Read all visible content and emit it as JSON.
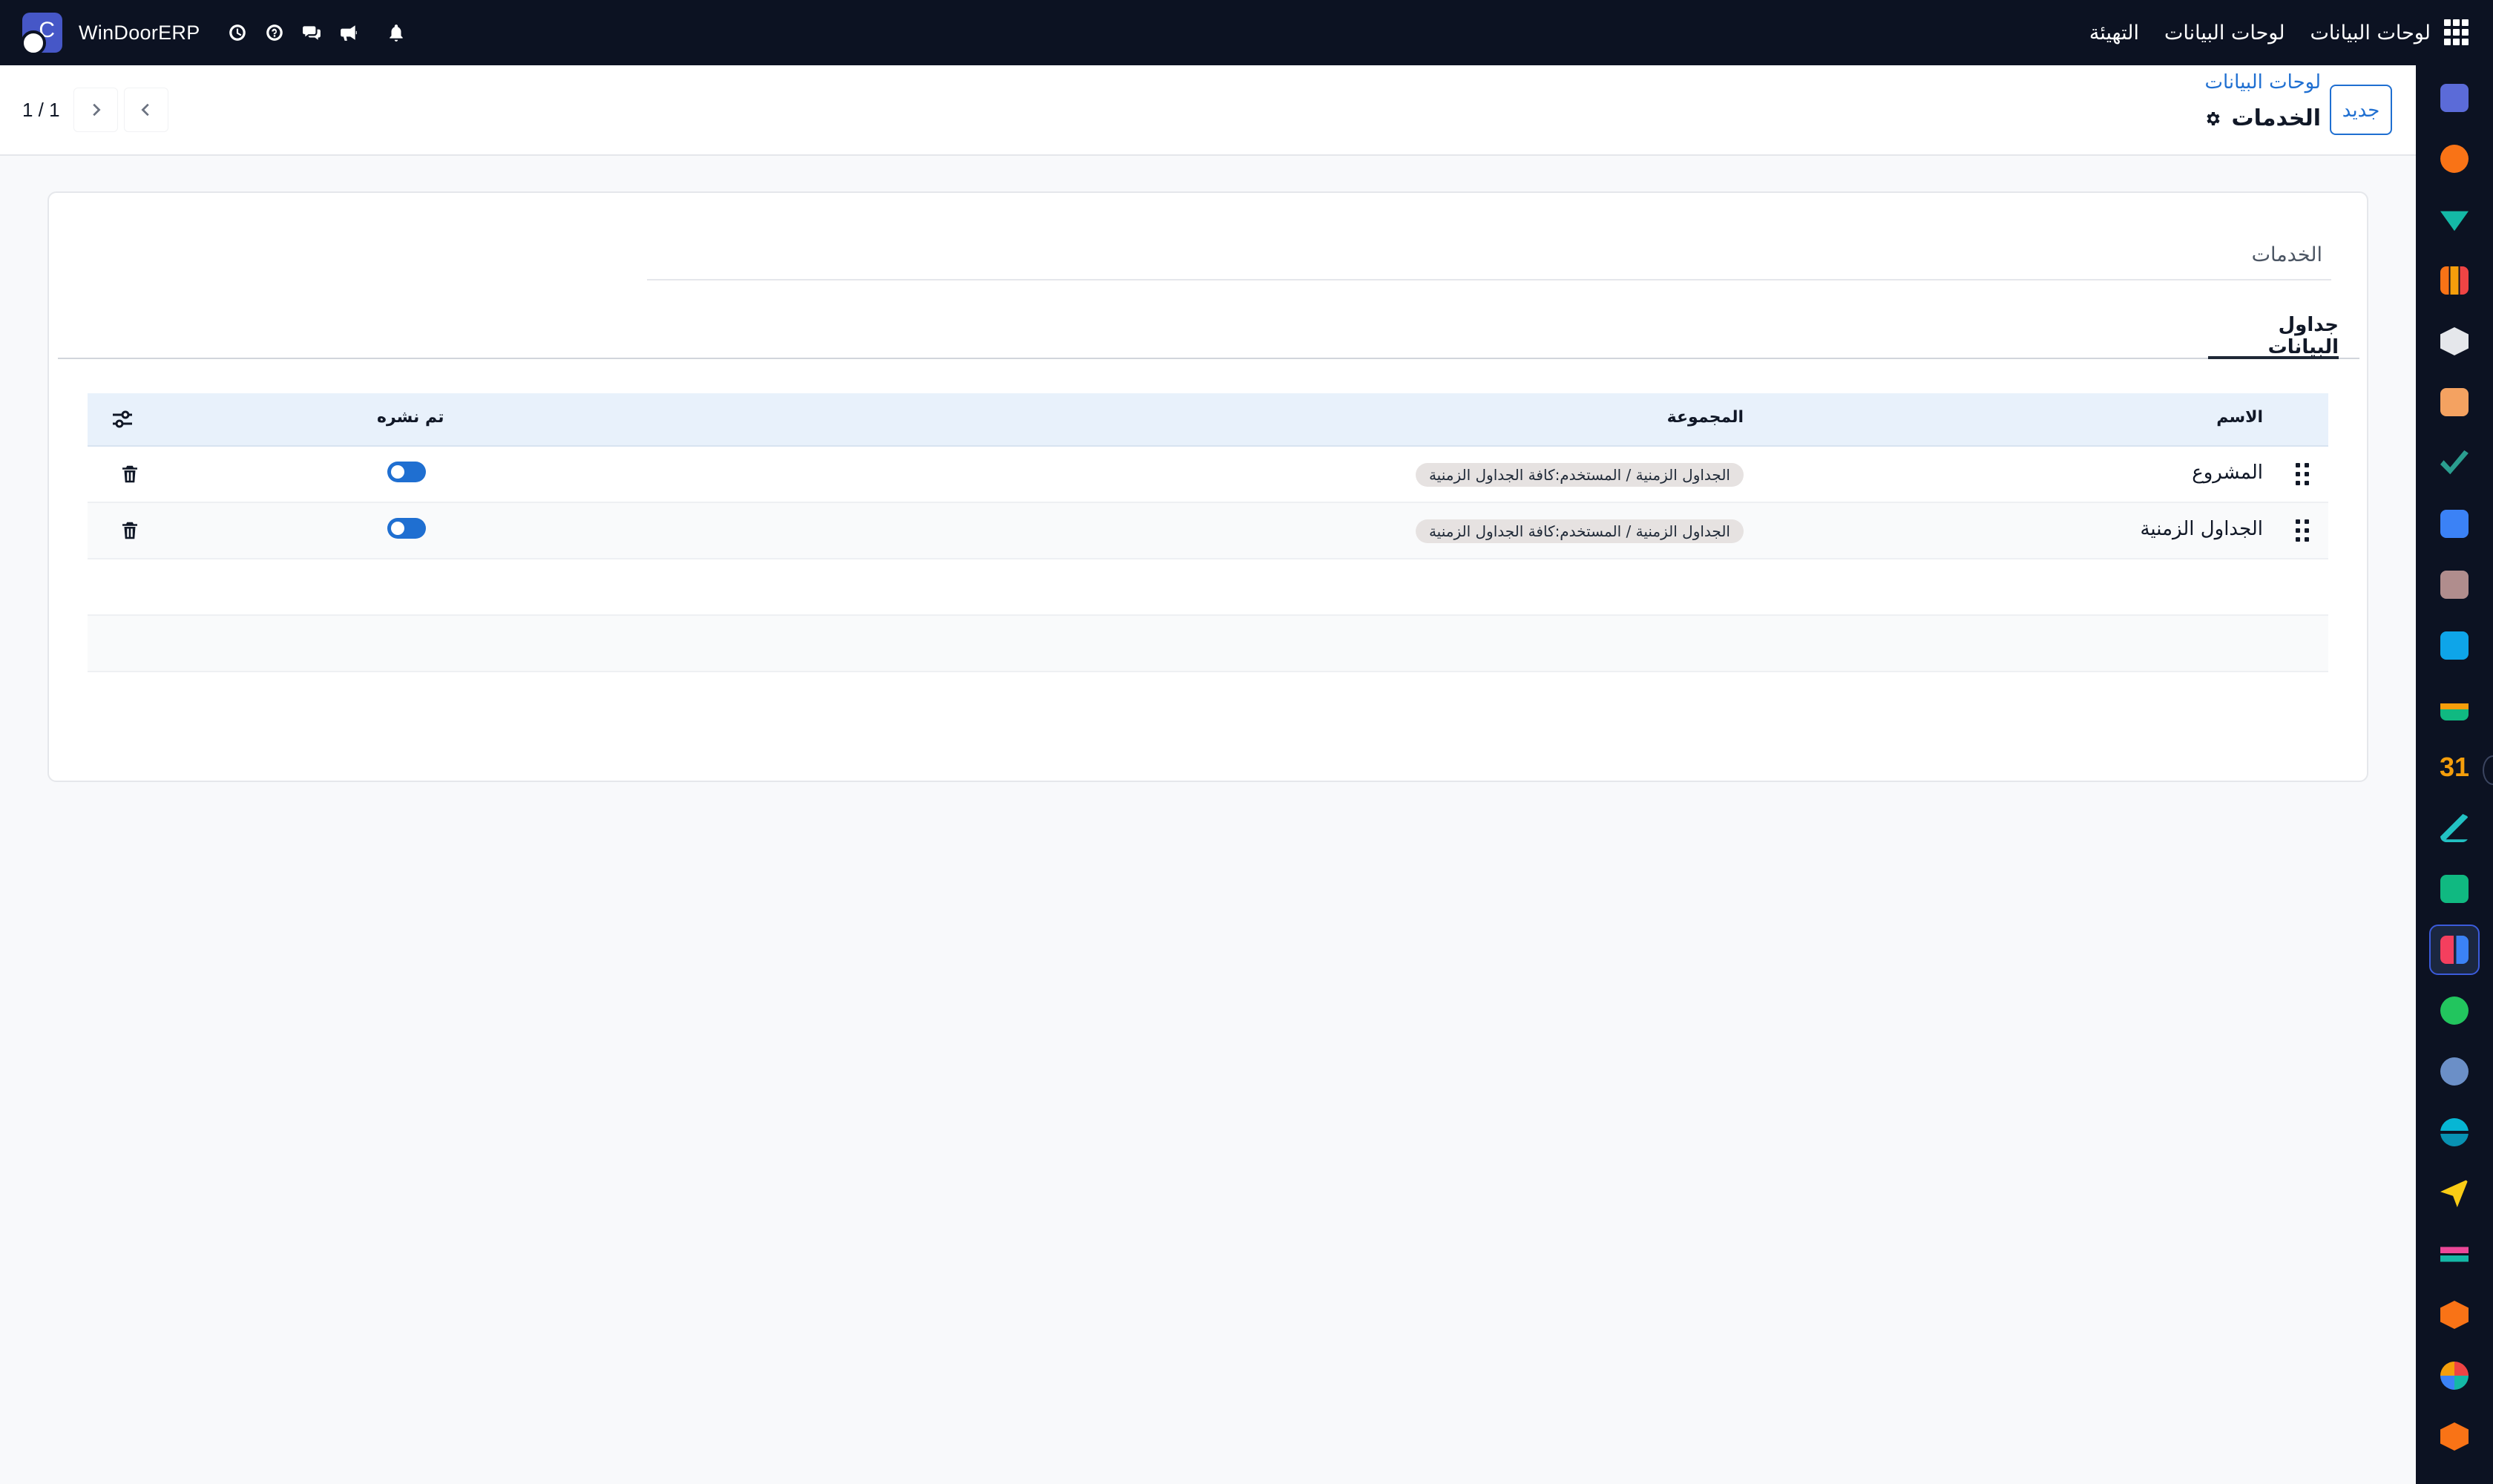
{
  "topbar": {
    "brand": "WinDoorERP",
    "menu": [
      "لوحات البيانات",
      "لوحات البيانات",
      "التهيئة"
    ],
    "icons": [
      "clock-icon",
      "help-icon",
      "chat-icon",
      "megaphone-icon",
      "bell-icon",
      "apps-grid-icon"
    ]
  },
  "control": {
    "new_button": "جديد",
    "breadcrumb": "لوحات البيانات",
    "title": "الخدمات",
    "pager": "1 / 1"
  },
  "form": {
    "name_value": "الخدمات",
    "tab_label": "جداول البيانات",
    "table": {
      "headers": {
        "name": "الاسم",
        "group": "المجموعة",
        "published": "تم نشره"
      },
      "rows": [
        {
          "name": "المشروع",
          "group": "الجداول الزمنية / المستخدم:كافة الجداول الزمنية",
          "published": true
        },
        {
          "name": "الجداول الزمنية",
          "group": "الجداول الزمنية / المستخدم:كافة الجداول الزمنية",
          "published": true
        }
      ]
    }
  },
  "colors": {
    "nav_bg": "#0c1222",
    "accent": "#1f6fd1",
    "header_bg": "#e8f1fb"
  }
}
